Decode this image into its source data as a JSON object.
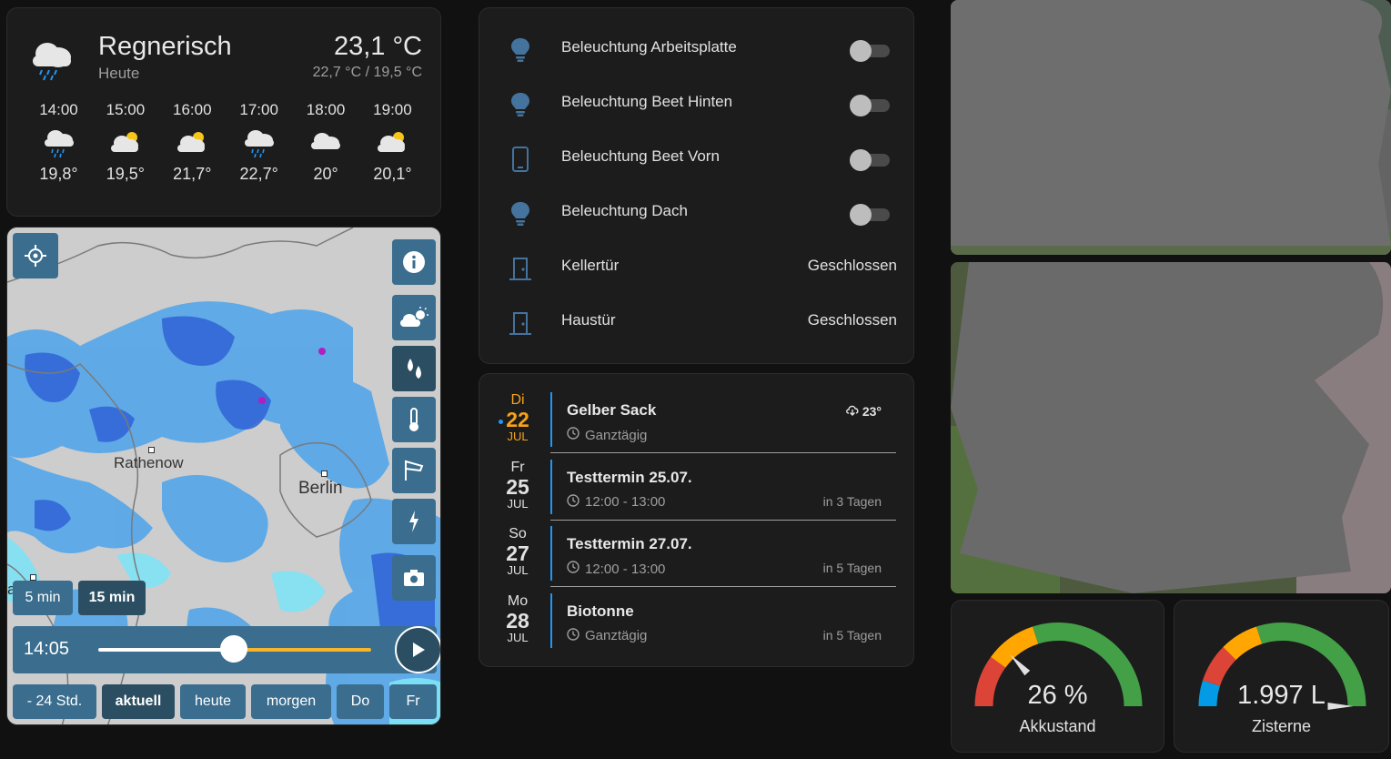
{
  "weather": {
    "condition": "Regnerisch",
    "day": "Heute",
    "temperature": "23,1 °C",
    "range": "22,7 °C / 19,5 °C",
    "main_icon": "cloud-rain-icon",
    "hours": [
      {
        "time": "14:00",
        "icon": "cloud-rain-icon",
        "temp": "19,8°"
      },
      {
        "time": "15:00",
        "icon": "partly-cloudy-icon",
        "temp": "19,5°"
      },
      {
        "time": "16:00",
        "icon": "partly-cloudy-icon",
        "temp": "21,7°"
      },
      {
        "time": "17:00",
        "icon": "cloud-rain-icon",
        "temp": "22,7°"
      },
      {
        "time": "18:00",
        "icon": "cloud-icon",
        "temp": "20°"
      },
      {
        "time": "19:00",
        "icon": "partly-cloudy-icon",
        "temp": "20,1°"
      }
    ]
  },
  "radar": {
    "cities": [
      "Rathenow",
      "Berlin",
      "agdeburg"
    ],
    "interval_buttons": [
      "5 min",
      "15 min"
    ],
    "active_interval": "15 min",
    "time": "14:05",
    "slider_progress": 0.5,
    "range_buttons": [
      "- 24 Std.",
      "aktuell",
      "heute",
      "morgen",
      "Do",
      "Fr"
    ],
    "active_range": "aktuell",
    "side_buttons": [
      "info-icon",
      "weather-layer-icon",
      "rain-layer-icon",
      "temperature-layer-icon",
      "wind-layer-icon",
      "lightning-layer-icon",
      "camera-icon"
    ],
    "locate_icon": "crosshair-icon"
  },
  "entities": [
    {
      "name": "Beleuchtung Arbeitsplatte",
      "icon": "lightbulb-icon",
      "type": "toggle",
      "on": false
    },
    {
      "name": "Beleuchtung Beet Hinten",
      "icon": "lightbulb-icon",
      "type": "toggle",
      "on": false
    },
    {
      "name": "Beleuchtung Beet Vorn",
      "icon": "tablet-icon",
      "type": "toggle",
      "on": false
    },
    {
      "name": "Beleuchtung Dach",
      "icon": "lightbulb-icon",
      "type": "toggle",
      "on": false
    },
    {
      "name": "Kellertür",
      "icon": "door-icon",
      "type": "state",
      "state": "Geschlossen"
    },
    {
      "name": "Haustür",
      "icon": "door-icon",
      "type": "state",
      "state": "Geschlossen"
    }
  ],
  "calendar": {
    "events": [
      {
        "dow": "Di",
        "day": "22",
        "month": "JUL",
        "title": "Gelber Sack",
        "time": "Ganztägig",
        "relative": "",
        "weather": "23°",
        "today": true
      },
      {
        "dow": "Fr",
        "day": "25",
        "month": "JUL",
        "title": "Testtermin 25.07.",
        "time": "12:00 - 13:00",
        "relative": "in 3 Tagen",
        "today": false
      },
      {
        "dow": "So",
        "day": "27",
        "month": "JUL",
        "title": "Testtermin 27.07.",
        "time": "12:00 - 13:00",
        "relative": "in 5 Tagen",
        "today": false
      },
      {
        "dow": "Mo",
        "day": "28",
        "month": "JUL",
        "title": "Biotonne",
        "time": "Ganztägig",
        "relative": "in 5 Tagen",
        "today": false
      }
    ]
  },
  "gauges": [
    {
      "value_text": "26 %",
      "label": "Akkustand",
      "fraction": 0.26,
      "segments": [
        {
          "from": 0,
          "to": 0.2,
          "color": "#db4437"
        },
        {
          "from": 0.2,
          "to": 0.4,
          "color": "#ffa600"
        },
        {
          "from": 0.4,
          "to": 1,
          "color": "#43a047"
        }
      ]
    },
    {
      "value_text": "1.997 L",
      "label": "Zisterne",
      "fraction": 1.0,
      "segments": [
        {
          "from": 0,
          "to": 0.1,
          "color": "#039be5"
        },
        {
          "from": 0.1,
          "to": 0.25,
          "color": "#db4437"
        },
        {
          "from": 0.25,
          "to": 0.4,
          "color": "#ffa600"
        },
        {
          "from": 0.4,
          "to": 1,
          "color": "#43a047"
        }
      ]
    }
  ],
  "colors": {
    "accent": "#2196f3",
    "today": "#f7a21b",
    "entity_icon": "#44739e",
    "radar_button": "#3a6d8e"
  }
}
